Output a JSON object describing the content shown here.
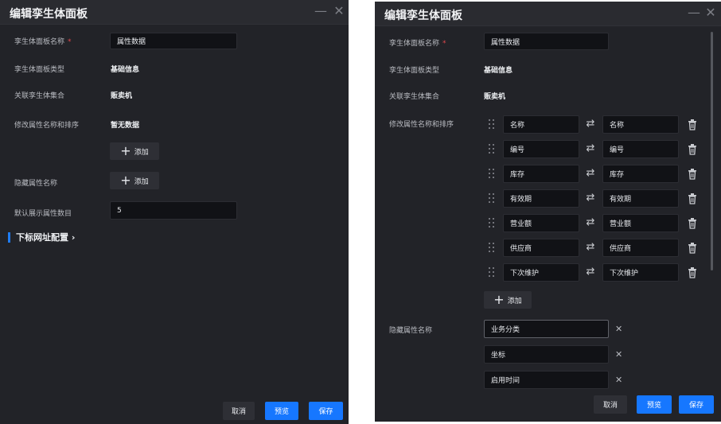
{
  "p1": {
    "title": "编辑孪生体面板",
    "name_label": "孪生体面板名称",
    "name_value": "属性数据",
    "type_label": "孪生体面板类型",
    "type_value": "基础信息",
    "set_label": "关联孪生体集合",
    "set_value": "贩卖机",
    "rename_label": "修改属性名称和排序",
    "rename_value": "暂无数据",
    "add_label": "添加",
    "hide_label": "隐藏属性名称",
    "hide_add_label": "添加",
    "count_label": "默认展示属性数目",
    "count_value": "5",
    "section_label": "下标网址配置",
    "cancel": "取消",
    "preview": "预览",
    "save": "保存"
  },
  "p2": {
    "title": "编辑孪生体面板",
    "name_label": "孪生体面板名称",
    "name_value": "属性数据",
    "type_label": "孪生体面板类型",
    "type_value": "基础信息",
    "set_label": "关联孪生体集合",
    "set_value": "贩卖机",
    "rename_label": "修改属性名称和排序",
    "mappings": [
      {
        "from": "名称",
        "to": "名称"
      },
      {
        "from": "编号",
        "to": "编号"
      },
      {
        "from": "库存",
        "to": "库存"
      },
      {
        "from": "有效期",
        "to": "有效期"
      },
      {
        "from": "营业额",
        "to": "营业额"
      },
      {
        "from": "供应商",
        "to": "供应商"
      },
      {
        "from": "下次维护",
        "to": "下次维护"
      }
    ],
    "add_label": "添加",
    "hide_label": "隐藏属性名称",
    "hidden": [
      "业务分类",
      "坐标",
      "启用时间"
    ],
    "cancel": "取消",
    "preview": "预览",
    "save": "保存"
  },
  "icons": {
    "minimize": "minimize-icon",
    "close": "close-icon",
    "drag": "drag-handle-icon",
    "swap": "swap-icon",
    "delete": "trash-icon",
    "remove": "x-icon",
    "add": "plus-icon",
    "chevron": "chevron-right-icon"
  },
  "colors": {
    "panel_bg": "#222328",
    "input_bg": "#111216",
    "accent": "#1677ff",
    "required": "#e2474c"
  }
}
